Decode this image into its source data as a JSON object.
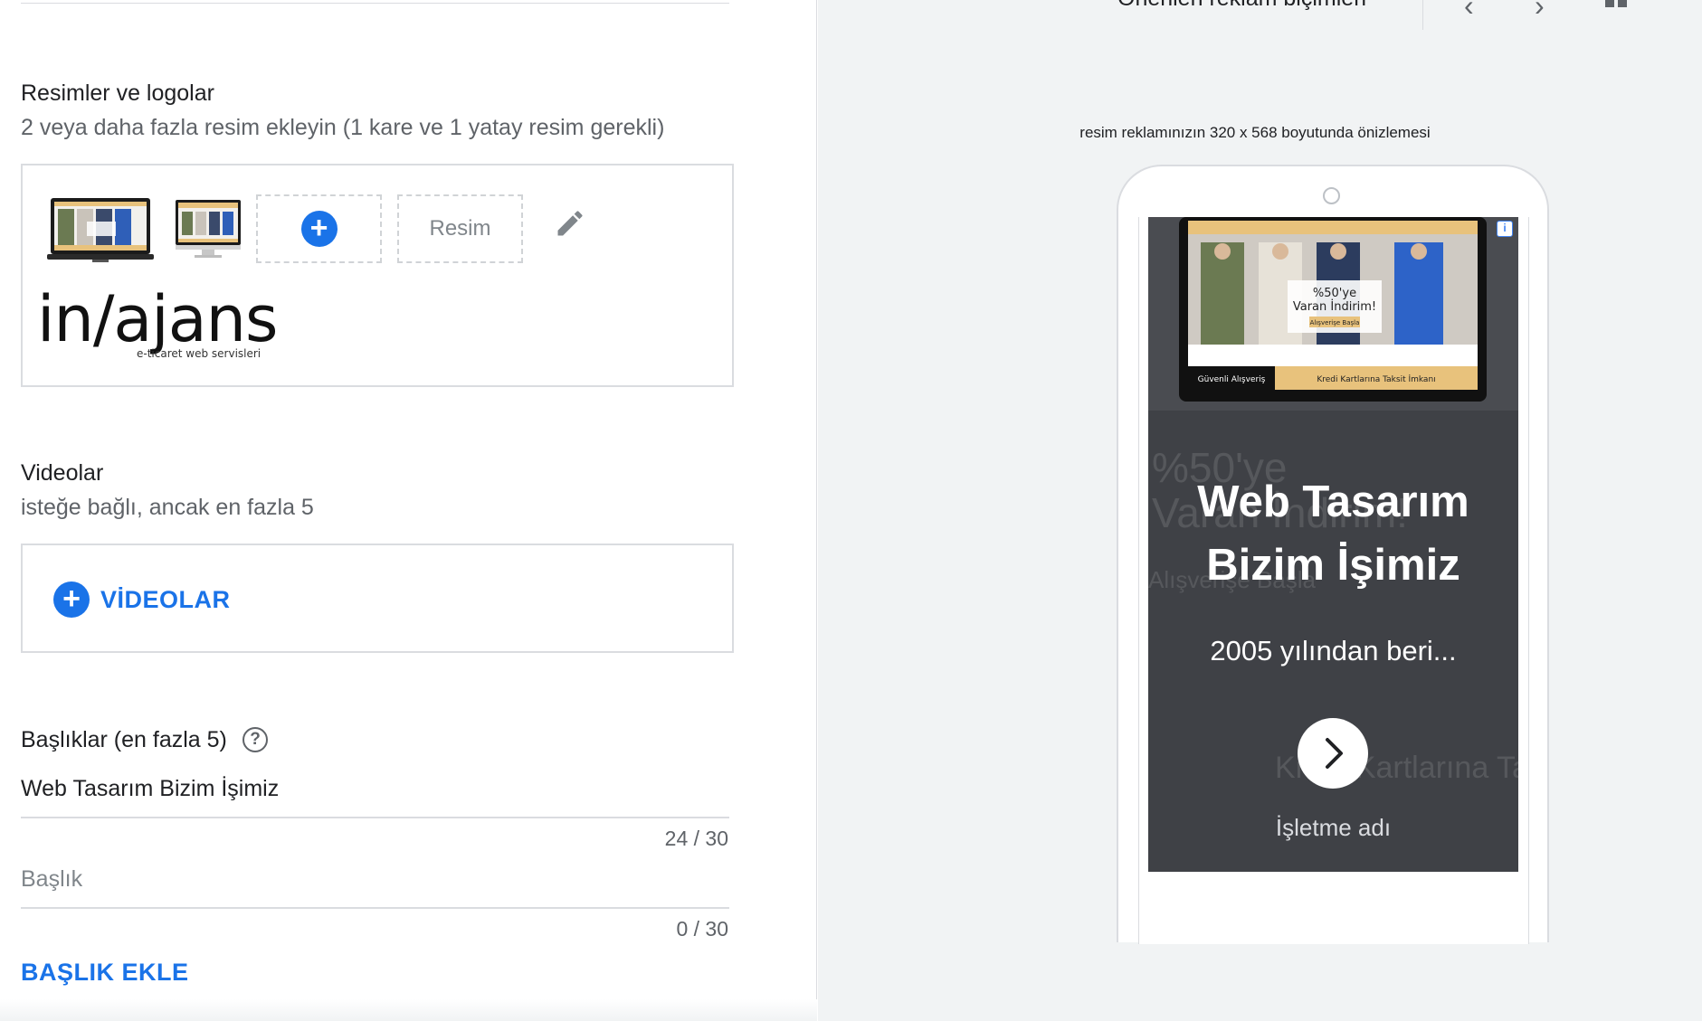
{
  "images_section": {
    "title": "Resimler ve logolar",
    "subtitle": "2 veya daha fazla resim ekleyin (1 kare ve 1 yatay resim gerekli)",
    "image_slot_label": "Resim",
    "logo_text": "in/ajans",
    "logo_tagline": "e-ticaret web servisleri"
  },
  "videos_section": {
    "title": "Videolar",
    "subtitle": "isteğe bağlı, ancak en fazla 5",
    "add_button_label": "VİDEOLAR"
  },
  "headlines_section": {
    "title": "Başlıklar (en fazla 5)",
    "help_icon": "?",
    "fields": [
      {
        "value": "Web Tasarım Bizim İşimiz",
        "placeholder": "",
        "counter": "24 / 30"
      },
      {
        "value": "",
        "placeholder": "Başlık",
        "counter": "0 / 30"
      }
    ],
    "add_link_label": "BAŞLIK EKLE"
  },
  "preview": {
    "header_title": "Önerilen reklam biçimleri",
    "prev_icon": "‹",
    "next_icon": "›",
    "caption": "resim reklamınızın 320 x 568 boyutunda önizlemesi",
    "ad": {
      "headline_line1": "Web Tasarım",
      "headline_line2": "Bizim İşimiz",
      "description": "2005 yılından beri...",
      "business_name": "İşletme adı",
      "info_icon": "i",
      "promo_text_line1": "%50'ye",
      "promo_text_line2": "Varan İndirim!",
      "promo_button": "Alışverişe Başla",
      "footer_left": "Güvenli Alışveriş",
      "footer_right": "Kredi Kartlarına Taksit İmkanı"
    }
  },
  "colors": {
    "accent_blue": "#1a73e8",
    "ad_background": "#3f4146",
    "panel_gray": "#f1f3f4",
    "border": "#dadce0",
    "banner_gold": "#e8c27c"
  },
  "icons": [
    "add-circle-icon",
    "pencil-icon",
    "help-circle-icon",
    "chevron-left-icon",
    "chevron-right-icon",
    "grid-icon",
    "ad-info-icon",
    "chevron-right-circle-icon",
    "camera-dot-icon"
  ]
}
